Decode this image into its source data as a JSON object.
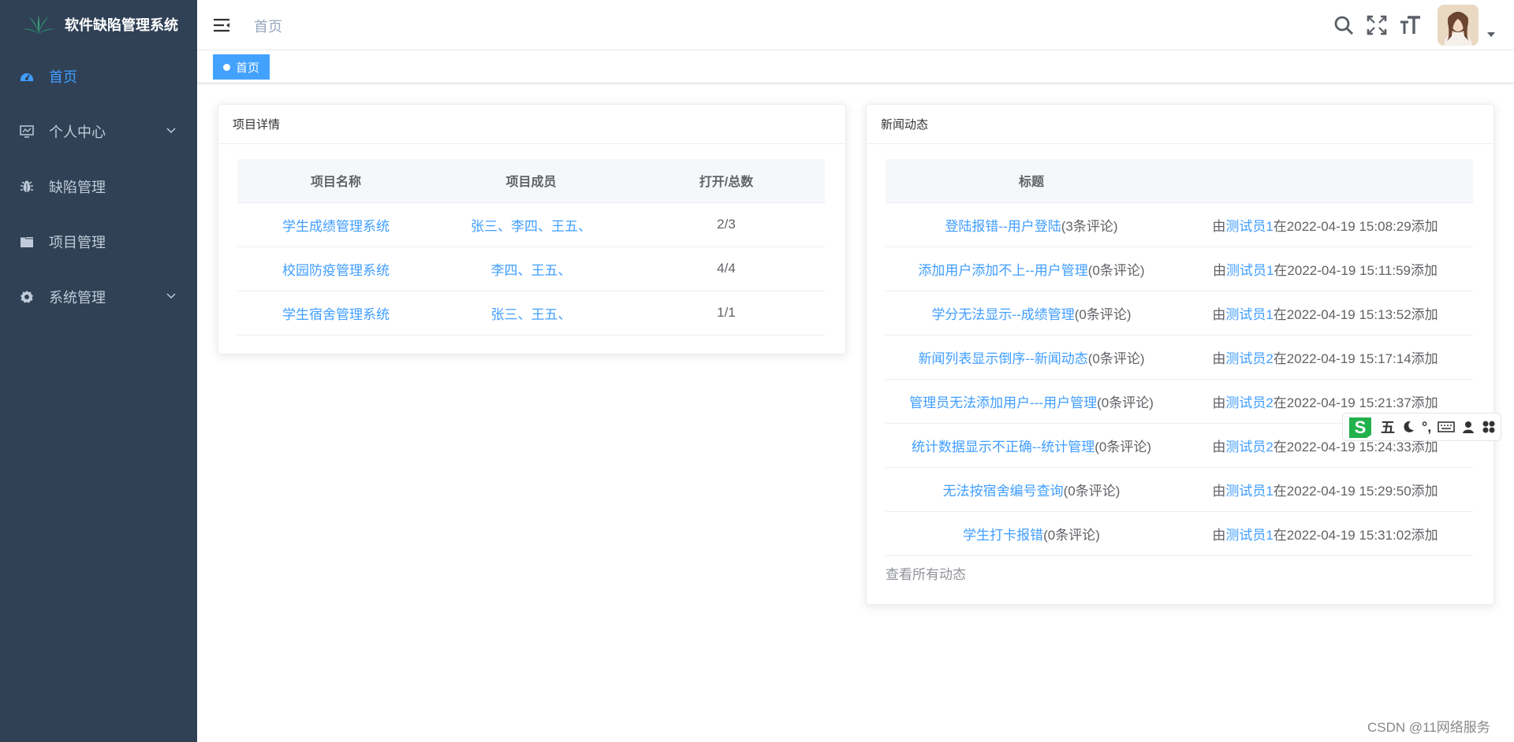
{
  "app": {
    "title": "软件缺陷管理系统"
  },
  "sidebar": {
    "items": [
      {
        "label": "首页",
        "icon": "dashboard-icon",
        "active": true
      },
      {
        "label": "个人中心",
        "icon": "monitor-icon",
        "expandable": true
      },
      {
        "label": "缺陷管理",
        "icon": "bug-icon"
      },
      {
        "label": "项目管理",
        "icon": "folder-icon"
      },
      {
        "label": "系统管理",
        "icon": "gear-icon",
        "expandable": true
      }
    ]
  },
  "navbar": {
    "breadcrumb": "首页",
    "icons": [
      "search-icon",
      "fullscreen-icon",
      "font-size-icon"
    ]
  },
  "tags": {
    "active": "首页"
  },
  "project_card": {
    "title": "项目详情",
    "columns": [
      "项目名称",
      "项目成员",
      "打开/总数"
    ],
    "rows": [
      {
        "name": "学生成绩管理系统",
        "members": "张三、李四、王五、",
        "ratio": "2/3"
      },
      {
        "name": "校园防疫管理系统",
        "members": "李四、王五、",
        "ratio": "4/4"
      },
      {
        "name": "学生宿舍管理系统",
        "members": "张三、王五、",
        "ratio": "1/1"
      }
    ]
  },
  "news_card": {
    "title": "新闻动态",
    "column": "标题",
    "by": "由",
    "at": "在",
    "added": "添加",
    "rows": [
      {
        "title": "登陆报错--用户登陆",
        "comments": "(3条评论)",
        "user": "测试员1",
        "time": "2022-04-19 15:08:29"
      },
      {
        "title": "添加用户添加不上--用户管理",
        "comments": "(0条评论)",
        "user": "测试员1",
        "time": "2022-04-19 15:11:59"
      },
      {
        "title": "学分无法显示--成绩管理",
        "comments": "(0条评论)",
        "user": "测试员1",
        "time": "2022-04-19 15:13:52"
      },
      {
        "title": "新闻列表显示倒序--新闻动态",
        "comments": "(0条评论)",
        "user": "测试员2",
        "time": "2022-04-19 15:17:14"
      },
      {
        "title": "管理员无法添加用户---用户管理",
        "comments": "(0条评论)",
        "user": "测试员2",
        "time": "2022-04-19 15:21:37"
      },
      {
        "title": "统计数据显示不正确--统计管理",
        "comments": "(0条评论)",
        "user": "测试员2",
        "time": "2022-04-19 15:24:33"
      },
      {
        "title": "无法按宿舍编号查询",
        "comments": "(0条评论)",
        "user": "测试员1",
        "time": "2022-04-19 15:29:50"
      },
      {
        "title": "学生打卡报错",
        "comments": "(0条评论)",
        "user": "测试员1",
        "time": "2022-04-19 15:31:02"
      }
    ],
    "view_all": "查看所有动态"
  },
  "ime": {
    "mode": "五",
    "punct": "°,"
  },
  "watermark": "CSDN @11网络服务",
  "colors": {
    "sidebar_bg": "#304156",
    "accent": "#409eff",
    "tag_bg": "#42a2fd"
  }
}
